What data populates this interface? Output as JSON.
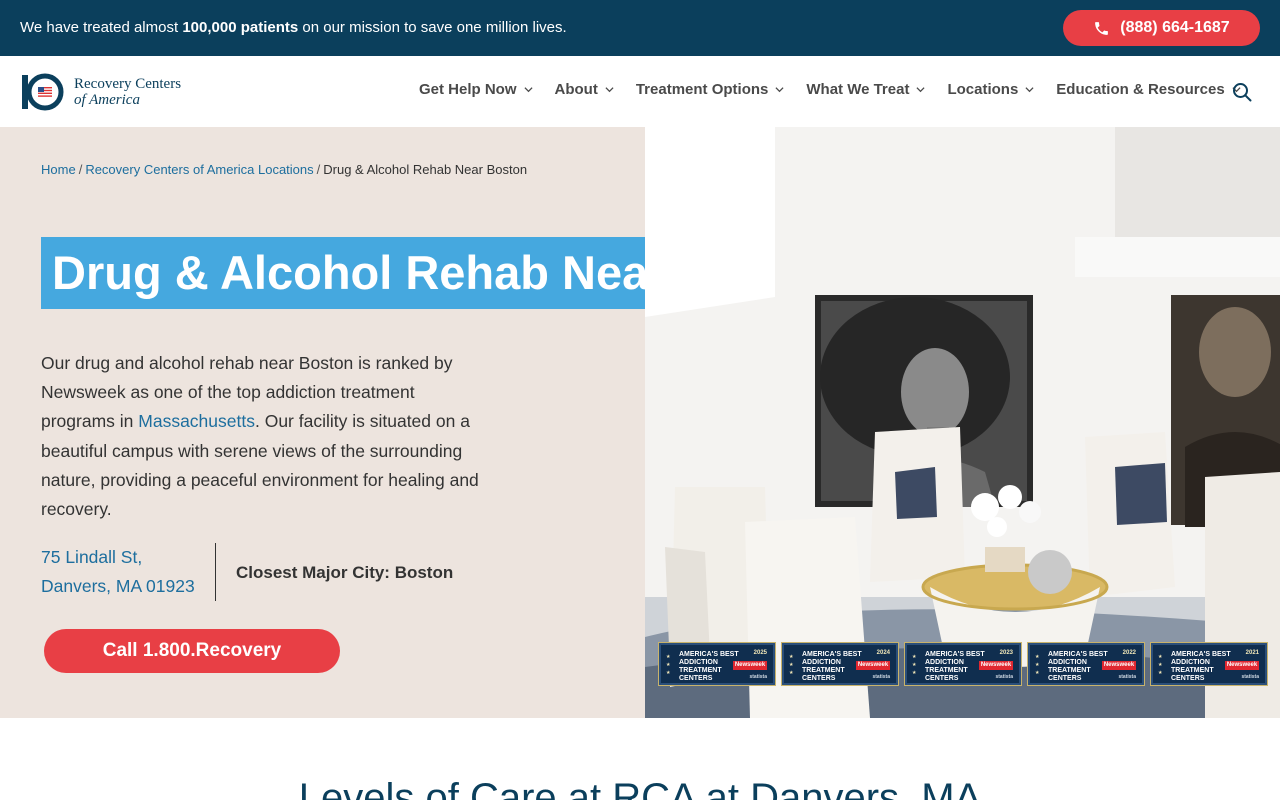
{
  "topbar": {
    "message_prefix": "We have treated almost ",
    "message_bold": "100,000 patients",
    "message_suffix": " on our mission to save one million lives.",
    "phone": "(888) 664-1687"
  },
  "brand": {
    "name_line1": "Recovery Centers",
    "name_line2": "of America",
    "accent": "#0b3f5c",
    "cta_color": "#e83f45",
    "title_bg": "#45a8df"
  },
  "nav": [
    "Get Help Now",
    "About",
    "Treatment Options",
    "What We Treat",
    "Locations",
    "Education & Resources"
  ],
  "breadcrumb": {
    "home": "Home",
    "locations": "Recovery Centers of America Locations",
    "current": "Drug & Alcohol Rehab Near Boston",
    "separator": "/"
  },
  "hero": {
    "title": "Drug & Alcohol Rehab Near Boston",
    "desc_part1": "Our drug and alcohol rehab near Boston is ranked by Newsweek as one of the top addiction treatment programs in ",
    "desc_link": "Massachusetts",
    "desc_part2": ". Our facility is situated on a beautiful campus with serene views of the surrounding nature, providing a peaceful environment for healing and recovery.",
    "address_line1": "75 Lindall St,",
    "address_line2": "Danvers, MA 01923",
    "closest_city": "Closest Major City: Boston",
    "cta": "Call 1.800.Recovery"
  },
  "badges": [
    {
      "line1": "AMERICA'S BEST",
      "line2": "ADDICTION TREATMENT",
      "line3": "CENTERS",
      "year": "2025",
      "brand": "Newsweek",
      "partner": "statista"
    },
    {
      "line1": "AMERICA'S BEST",
      "line2": "ADDICTION",
      "line3": "TREATMENT CENTERS",
      "year": "2024",
      "brand": "Newsweek",
      "partner": "statista"
    },
    {
      "line1": "AMERICA'S BEST",
      "line2": "ADDICTION",
      "line3": "TREATMENT CENTERS",
      "year": "2023",
      "brand": "Newsweek",
      "partner": "statista"
    },
    {
      "line1": "AMERICA'S BEST",
      "line2": "ADDICTION",
      "line3": "TREATMENT CENTERS",
      "year": "2022",
      "brand": "Newsweek",
      "partner": "statista"
    },
    {
      "line1": "AMERICA'S BEST",
      "line2": "ADDICTION",
      "line3": "TREATMENT CENTERS",
      "year": "2021",
      "brand": "Newsweek",
      "partner": "statista"
    }
  ],
  "section": {
    "levels_title": "Levels of Care at RCA at Danvers, MA"
  },
  "icons": {
    "phone": "phone-icon",
    "search": "search-icon",
    "chevron": "chevron-down-icon"
  }
}
